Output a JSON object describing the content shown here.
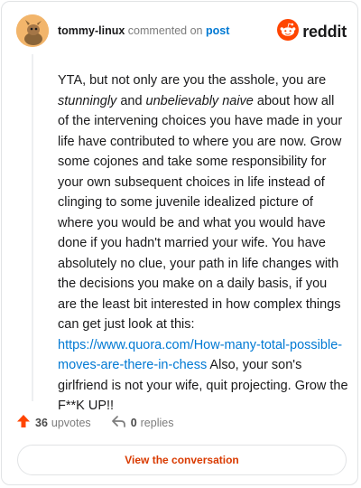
{
  "header": {
    "username": "tommy-linux",
    "action_text": "commented on",
    "post_link": "post"
  },
  "brand": {
    "name": "reddit",
    "color": "#ff4500"
  },
  "comment": {
    "p1": "YTA, but not only are you the asshole, you are ",
    "em1": "stunningly",
    "p2": " and ",
    "em2": "unbelievably naive",
    "p3": " about how all of the intervening choices you have made in your life have contributed to where you are now. Grow some cojones and take some responsibility for your own subsequent choices in life instead of clinging to some juvenile idealized picture of where you would be and what you would have done if you hadn't married your wife. You have absolutely no clue, your path in life changes with the decisions you make on a daily basis, if you are the least bit interested in how complex things can get just look at this: ",
    "link": "https://www.quora.com/How-many-total-possible-moves-are-there-in-chess",
    "p4": " Also, your son's girlfriend is not your wife, quit projecting. Grow the F**K UP!!"
  },
  "actions": {
    "upvotes_count": "36",
    "upvotes_label": "upvotes",
    "replies_count": "0",
    "replies_label": "replies"
  },
  "view_button_label": "View the conversation",
  "colors": {
    "accent": "#ff4500",
    "link": "#0079d3",
    "button_text": "#d93a00"
  },
  "icons": [
    "avatar",
    "reddit-logo-icon",
    "upvote-arrow-icon",
    "reply-icon"
  ]
}
